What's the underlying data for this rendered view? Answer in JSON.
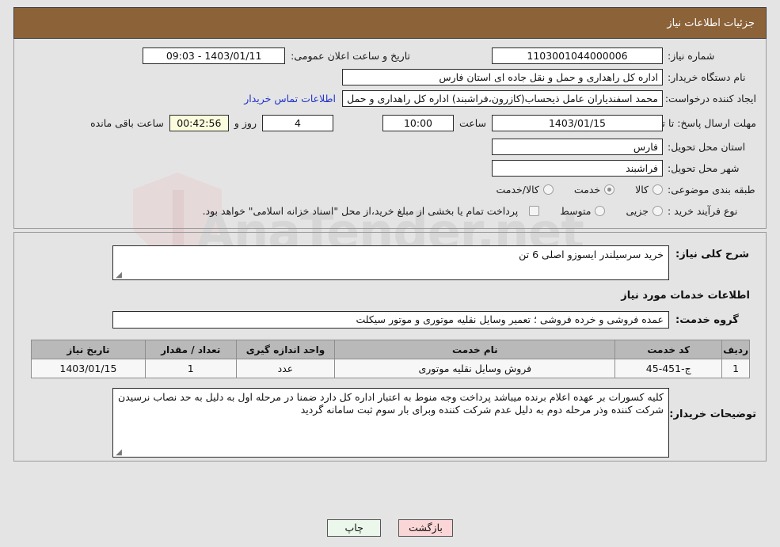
{
  "header": {
    "title": "جزئیات اطلاعات نیاز"
  },
  "form": {
    "need_number_label": "شماره نیاز:",
    "need_number_value": "1103001044000006",
    "public_announce_label": "تاریخ و ساعت اعلان عمومی:",
    "public_announce_value": "1403/01/11 - 09:03",
    "buyer_org_label": "نام دستگاه خریدار:",
    "buyer_org_value": "اداره کل راهداری و حمل و نقل جاده ای استان فارس",
    "creator_label": "ایجاد کننده درخواست:",
    "creator_value": "محمد اسفندیاران عامل ذیحساب(کازرون،فراشبند) اداره کل راهداری و حمل و نقل",
    "contact_link": "اطلاعات تماس خریدار",
    "deadline_label": "مهلت ارسال پاسخ: تا تاریخ:",
    "deadline_date": "1403/01/15",
    "hour_label": "ساعت",
    "deadline_time": "10:00",
    "days_value": "4",
    "days_label": "روز و",
    "countdown_value": "00:42:56",
    "countdown_label": "ساعت باقی مانده",
    "province_label": "استان محل تحویل:",
    "province_value": "فارس",
    "city_label": "شهر محل تحویل:",
    "city_value": "فراشبند",
    "category_label": "طبقه بندی موضوعی:",
    "category_options": [
      {
        "label": "کالا",
        "selected": false
      },
      {
        "label": "خدمت",
        "selected": true
      },
      {
        "label": "کالا/خدمت",
        "selected": false
      }
    ],
    "process_label": "نوع فرآیند خرید :",
    "process_options": [
      {
        "label": "جزیی",
        "selected": false
      },
      {
        "label": "متوسط",
        "selected": false
      }
    ],
    "treasury_checkbox_checked": false,
    "treasury_note": "پرداخت تمام یا بخشی از مبلغ خرید،از محل \"اسناد خزانه اسلامی\" خواهد بود."
  },
  "details": {
    "summary_label": "شرح کلی نیاز:",
    "summary_value": "خرید سرسیلندر ایسوزو اصلی 6 تن",
    "services_head": "اطلاعات خدمات مورد نیاز",
    "service_group_label": "گروه خدمت:",
    "service_group_value": "عمده فروشی و خرده فروشی ؛ تعمیر وسایل نقلیه موتوری و موتور سیکلت"
  },
  "table": {
    "columns": [
      "ردیف",
      "کد خدمت",
      "نام خدمت",
      "واحد اندازه گیری",
      "تعداد / مقدار",
      "تاریخ نیاز"
    ],
    "rows": [
      {
        "radif": "1",
        "code": "ج-451-45",
        "name": "فروش وسایل نقلیه موتوری",
        "unit": "عدد",
        "qty": "1",
        "date": "1403/01/15"
      }
    ]
  },
  "buyer_notes": {
    "label": "توضیحات خریدار:",
    "value": "کلیه کسورات بر عهده اعلام برنده میباشد پرداخت وجه منوط به اعتبار اداره کل دارد ضمنا در مرحله اول به دلیل به حد نصاب نرسیدن شرکت کننده وذر مرحله دوم به دلیل عدم شرکت کننده وبرای بار سوم ثبت سامانه گردید"
  },
  "footer": {
    "print_label": "چاپ",
    "back_label": "بازگشت"
  },
  "watermark": {
    "text": "AnaTender.net"
  }
}
